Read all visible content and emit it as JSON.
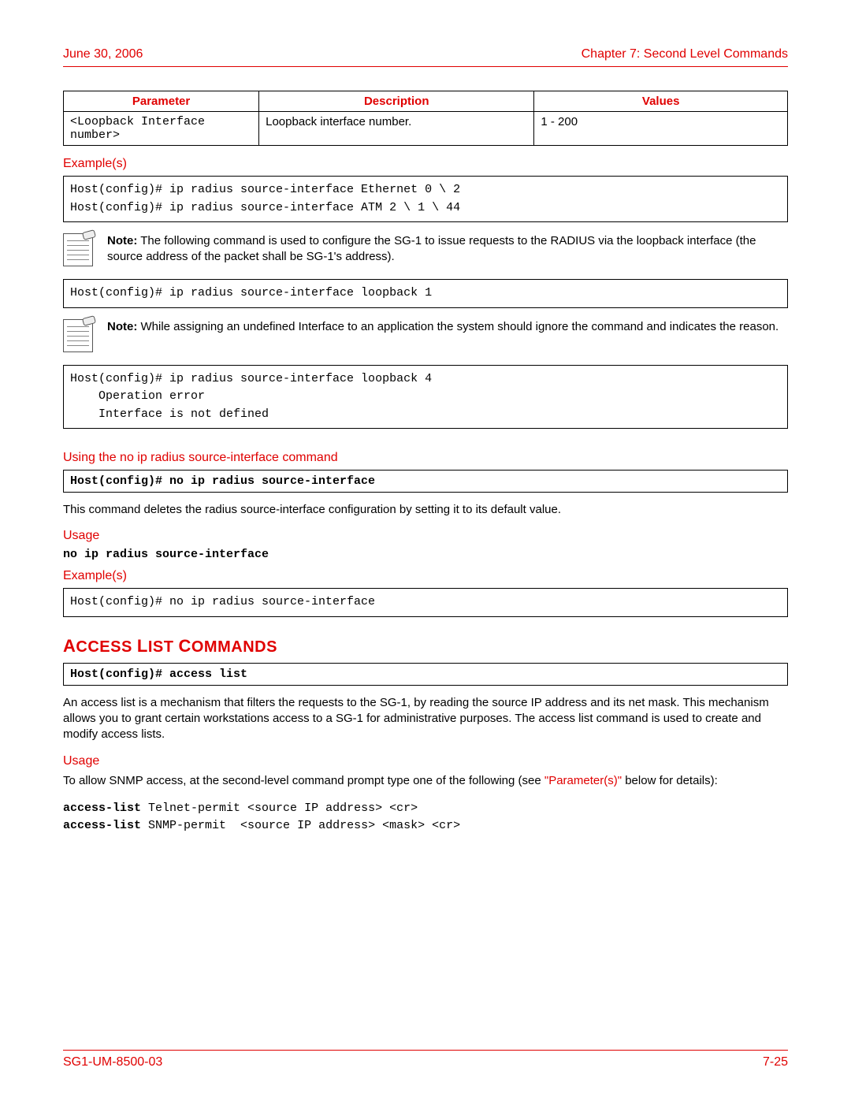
{
  "header": {
    "date": "June 30, 2006",
    "chapter": "Chapter 7: Second Level Commands"
  },
  "param_table": {
    "headers": [
      "Parameter",
      "Description",
      "Values"
    ],
    "row": {
      "param": "<Loopback Interface number>",
      "desc": "Loopback interface number.",
      "values": "1 - 200"
    }
  },
  "examples_label": "Example(s)",
  "example1_code": "Host(config)# ip radius source-interface Ethernet 0 \\ 2\nHost(config)# ip radius source-interface ATM 2 \\ 1 \\ 44",
  "note1_bold": "Note:",
  "note1_text": " The following command is used to configure the SG-1 to issue requests to the RADIUS via the loopback interface (the source address of the packet shall be SG-1's address).",
  "example2_code": "Host(config)# ip radius source-interface loopback 1",
  "note2_bold": "Note:",
  "note2_text": " While assigning an undefined Interface to an application the system should ignore the command and indicates the reason.",
  "example3_code": "Host(config)# ip radius source-interface loopback 4\n    Operation error\n    Interface is not defined",
  "no_cmd_heading": "Using the no ip radius source-interface command",
  "no_cmd_box": "Host(config)# no ip radius source-interface",
  "no_cmd_desc": "This command deletes the radius source-interface configuration by setting it to its default value.",
  "usage_label": "Usage",
  "no_cmd_usage": "no ip radius source-interface",
  "example4_code": "Host(config)# no ip radius source-interface",
  "access_section_title": "Access List Commands",
  "access_cmd_box": "Host(config)# access list",
  "access_desc": "An access list is a mechanism that filters the requests to the SG-1, by reading the source IP address and its net mask. This mechanism allows you to grant certain workstations access to a SG-1 for administrative purposes. The access list command is used to create and modify access lists.",
  "access_usage_pre": "To allow SNMP access, at the second-level command prompt type one of the following (see ",
  "access_usage_link": "\"Parameter(s)\"",
  "access_usage_post": " below for details):",
  "access_usage_lines": {
    "l1_bold": "access-list",
    "l1_rest": " Telnet-permit <source IP address> <cr>",
    "l2_bold": "access-list",
    "l2_rest": " SNMP-permit  <source IP address> <mask> <cr>"
  },
  "footer": {
    "docid": "SG1-UM-8500-03",
    "pagenum": "7-25"
  }
}
